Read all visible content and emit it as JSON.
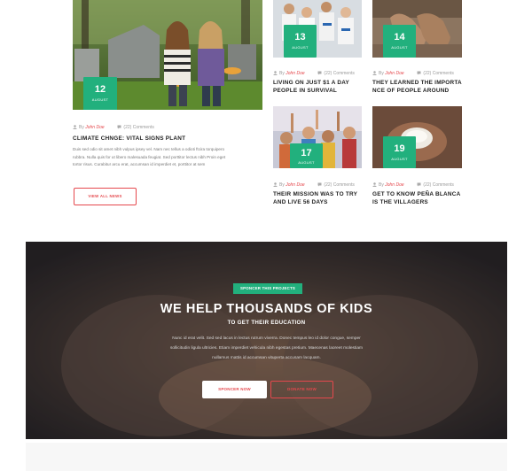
{
  "posts": {
    "featured": {
      "day": "12",
      "month": "AUGUST",
      "by": "By",
      "author": "John Doe",
      "comments": "(22) Comments",
      "title": "CLIMATE CHNGE: VITAL SIGNS PLANT",
      "excerpt": [
        "Duis sed odio sit amet nibh vulpus ipsey vel. Nam nec tellus a odioti ftcira torquipero",
        "rubbra. Nulla quis for ut libero malesuada feugiat. Sed porttitor lectus nibh Proin eget",
        "tortor risus. Curabitur arcu erat, accumsan id imperdiet et, porttitor at sem"
      ],
      "button": "VIEW ALL NEWS"
    },
    "cards": [
      {
        "day": "13",
        "month": "AUGUST",
        "by": "By",
        "author": "John Doe",
        "comments": "(22) Comments",
        "title_lines": [
          "LIVING ON JUST $1 A DAY",
          "PEOPLE IN SURVIVAL"
        ]
      },
      {
        "day": "14",
        "month": "AUGUST",
        "by": "By",
        "author": "John Doe",
        "comments": "(22) Comments",
        "title_lines": [
          "THEY LEARNED THE IMPORTA",
          "NCE OF PEOPLE AROUND"
        ]
      },
      {
        "day": "17",
        "month": "AUGUST",
        "by": "By",
        "author": "John Doe",
        "comments": "(22) Comments",
        "title_lines": [
          "THEIR MISSION WAS TO TRY",
          "AND LIVE 56 DAYS"
        ]
      },
      {
        "day": "19",
        "month": "AUGUST",
        "by": "By",
        "author": "John Doe",
        "comments": "(22) Comments",
        "title_lines": [
          "GET TO KNOW PEÑA BLANCA",
          "IS THE VILLAGERS"
        ]
      }
    ]
  },
  "hero": {
    "tag": "SPONCER THIS PROJECTS",
    "title": "WE HELP THOUSANDS OF KIDS",
    "subtitle": "TO GET THEIR EDUCATION",
    "text": [
      "Nunc id erat velit. Sed sed lacus in lectus rutrum viverra. Donec tempus leo id dolor congue, semper",
      "sollicitudin ligula ultricies. Etiam imperdiet vehicula nibh egestas pretium. Maecenas laoreet molestiam",
      "nullamus mattis id accumsan vituperta accusam lacquam."
    ],
    "button_primary": "SPONCER NOW",
    "button_secondary": "DONATE NOW"
  },
  "colors": {
    "accent_green": "#22b07d",
    "accent_red": "#e5484d"
  },
  "icons": {
    "author": "user-icon",
    "comments": "comment-icon"
  }
}
